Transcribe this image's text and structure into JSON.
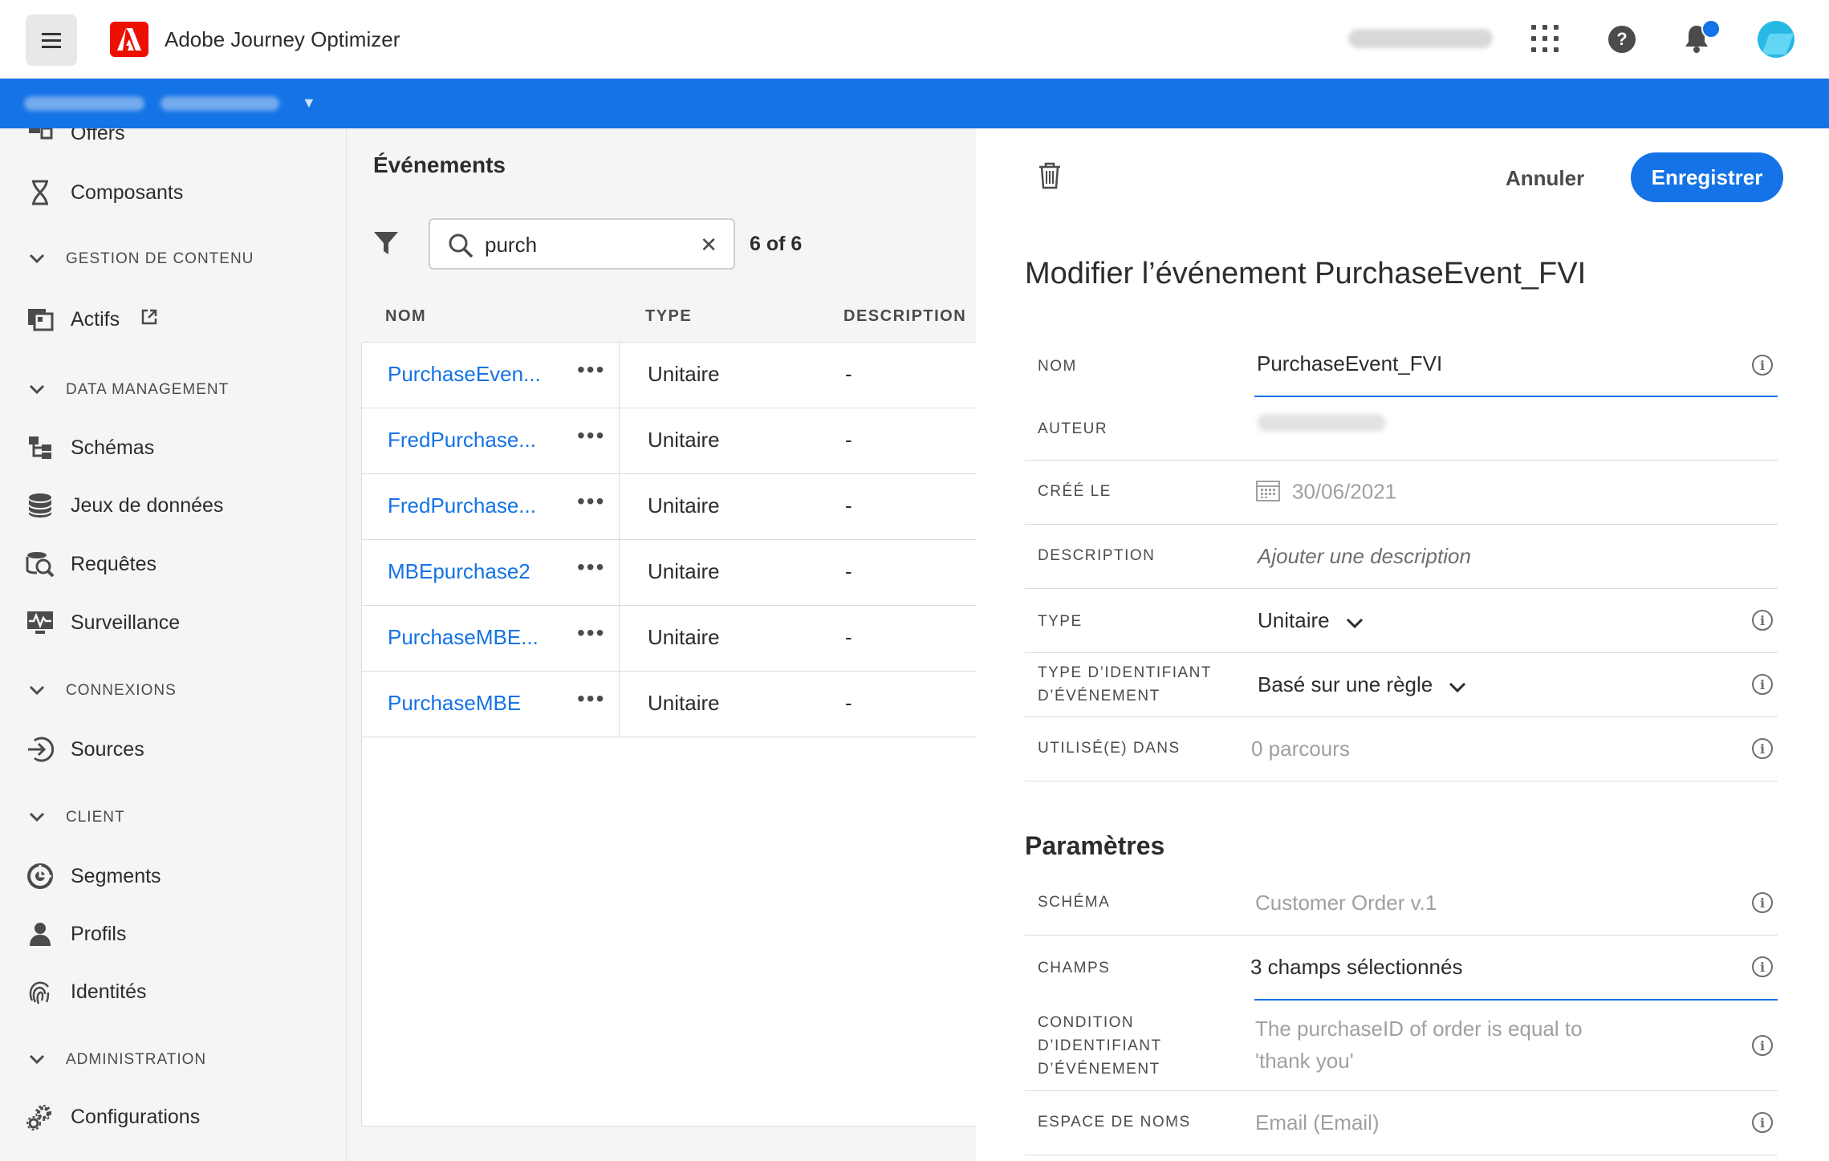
{
  "header": {
    "app_title": "Adobe Journey Optimizer",
    "notification_dot_color": "#1473e6",
    "accent_color": "#1473e6"
  },
  "sidebar": {
    "items": [
      {
        "label": "Offers",
        "icon": "offers-icon"
      },
      {
        "label": "Composants",
        "icon": "components-icon"
      }
    ],
    "sections": [
      {
        "title": "GESTION DE CONTENU",
        "items": [
          {
            "label": "Actifs",
            "icon": "assets-icon",
            "external": true
          }
        ]
      },
      {
        "title": "DATA MANAGEMENT",
        "items": [
          {
            "label": "Schémas",
            "icon": "schemas-icon"
          },
          {
            "label": "Jeux de données",
            "icon": "datasets-icon"
          },
          {
            "label": "Requêtes",
            "icon": "queries-icon"
          },
          {
            "label": "Surveillance",
            "icon": "monitoring-icon"
          }
        ]
      },
      {
        "title": "CONNEXIONS",
        "items": [
          {
            "label": "Sources",
            "icon": "sources-icon"
          }
        ]
      },
      {
        "title": "CLIENT",
        "items": [
          {
            "label": "Segments",
            "icon": "segments-icon"
          },
          {
            "label": "Profils",
            "icon": "profiles-icon"
          },
          {
            "label": "Identités",
            "icon": "identities-icon"
          }
        ]
      },
      {
        "title": "ADMINISTRATION",
        "items": [
          {
            "label": "Configurations",
            "icon": "configurations-icon"
          }
        ]
      }
    ]
  },
  "events_list": {
    "title": "Événements",
    "search": {
      "value": "purch"
    },
    "count": "6 of 6",
    "columns": [
      "NOM",
      "TYPE",
      "DESCRIPTION"
    ],
    "rows": [
      {
        "name": "PurchaseEven...",
        "type": "Unitaire",
        "description": "-"
      },
      {
        "name": "FredPurchase...",
        "type": "Unitaire",
        "description": "-"
      },
      {
        "name": "FredPurchase...",
        "type": "Unitaire",
        "description": "-"
      },
      {
        "name": "MBEpurchase2",
        "type": "Unitaire",
        "description": "-"
      },
      {
        "name": "PurchaseMBE...",
        "type": "Unitaire",
        "description": "-"
      },
      {
        "name": "PurchaseMBE",
        "type": "Unitaire",
        "description": "-"
      }
    ]
  },
  "detail": {
    "cancel_label": "Annuler",
    "save_label": "Enregistrer",
    "title": "Modifier l’événement PurchaseEvent_FVI",
    "properties": {
      "name": {
        "label": "NOM",
        "value": "PurchaseEvent_FVI"
      },
      "author": {
        "label": "AUTEUR"
      },
      "created": {
        "label": "CRÉÉ LE",
        "value": "30/06/2021"
      },
      "description": {
        "label": "DESCRIPTION",
        "placeholder": "Ajouter une description"
      },
      "type": {
        "label": "TYPE",
        "value": "Unitaire"
      },
      "id_type": {
        "label_line1": "TYPE D’IDENTIFIANT",
        "label_line2": "D’ÉVÉNEMENT",
        "value": "Basé sur une règle"
      },
      "used_in": {
        "label": "UTILISÉ(E) DANS",
        "value": "0 parcours"
      }
    },
    "params_title": "Paramètres",
    "params": {
      "schema": {
        "label": "SCHÉMA",
        "value": "Customer Order v.1"
      },
      "fields": {
        "label": "CHAMPS",
        "value": "3 champs sélectionnés"
      },
      "condition": {
        "label_line1": "CONDITION",
        "label_line2": "D’IDENTIFIANT",
        "label_line3": "D’ÉVÉNEMENT",
        "value_line1": "The purchaseID of order is equal to",
        "value_line2": "'thank you'"
      },
      "namespace": {
        "label": "ESPACE DE NOMS",
        "value": "Email (Email)"
      }
    }
  }
}
